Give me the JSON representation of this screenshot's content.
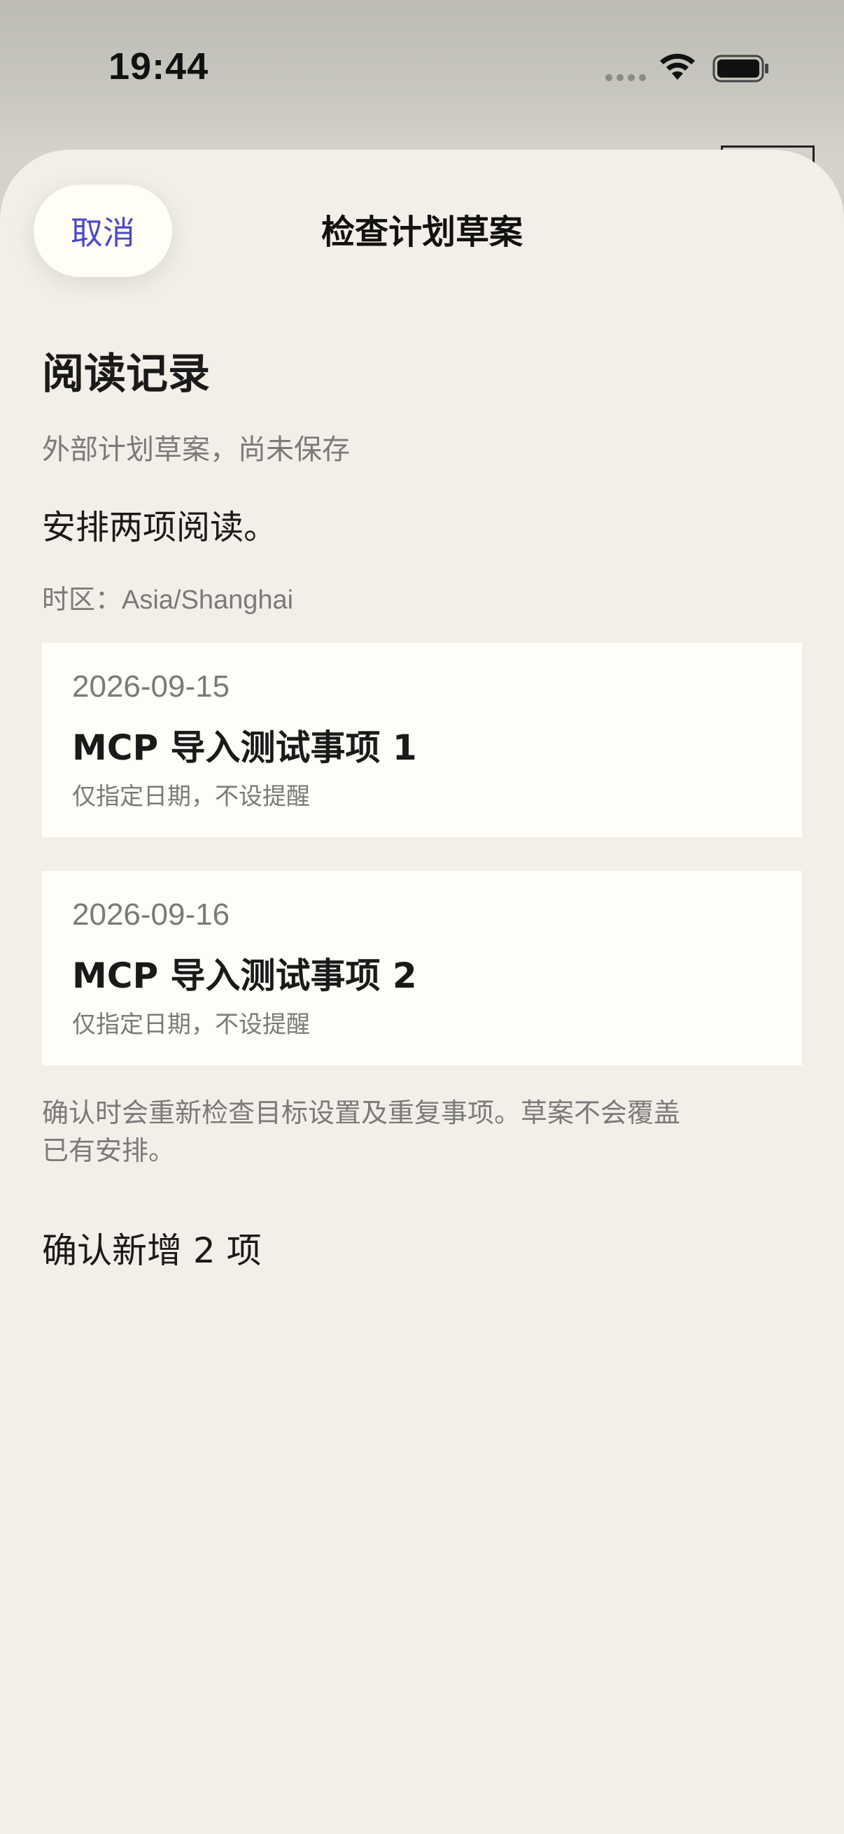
{
  "status_bar": {
    "time": "19:44",
    "icons": [
      "signal-dots-icon",
      "wifi-icon",
      "battery-icon"
    ]
  },
  "sheet": {
    "cancel_label": "取消",
    "title": "检查计划草案"
  },
  "plan": {
    "title": "阅读记录",
    "subtitle": "外部计划草案，尚未保存",
    "description": "安排两项阅读。",
    "timezone_label": "时区：",
    "timezone_value": "Asia/Shanghai"
  },
  "items": [
    {
      "date": "2026-09-15",
      "title": "MCP 导入测试事项 1",
      "note": "仅指定日期，不设提醒"
    },
    {
      "date": "2026-09-16",
      "title": "MCP 导入测试事项 2",
      "note": "仅指定日期，不设提醒"
    }
  ],
  "notice": {
    "line1": "确认时会重新检查目标设置及重复事项。草案不会覆盖",
    "line2": "已有安排。"
  },
  "confirm_label": "确认新增 2 项",
  "colors": {
    "accent": "#4a4ac6",
    "sheet_background": "#f3efe8",
    "card_background": "#fffdf7",
    "secondary_text": "#7a7a7a"
  }
}
